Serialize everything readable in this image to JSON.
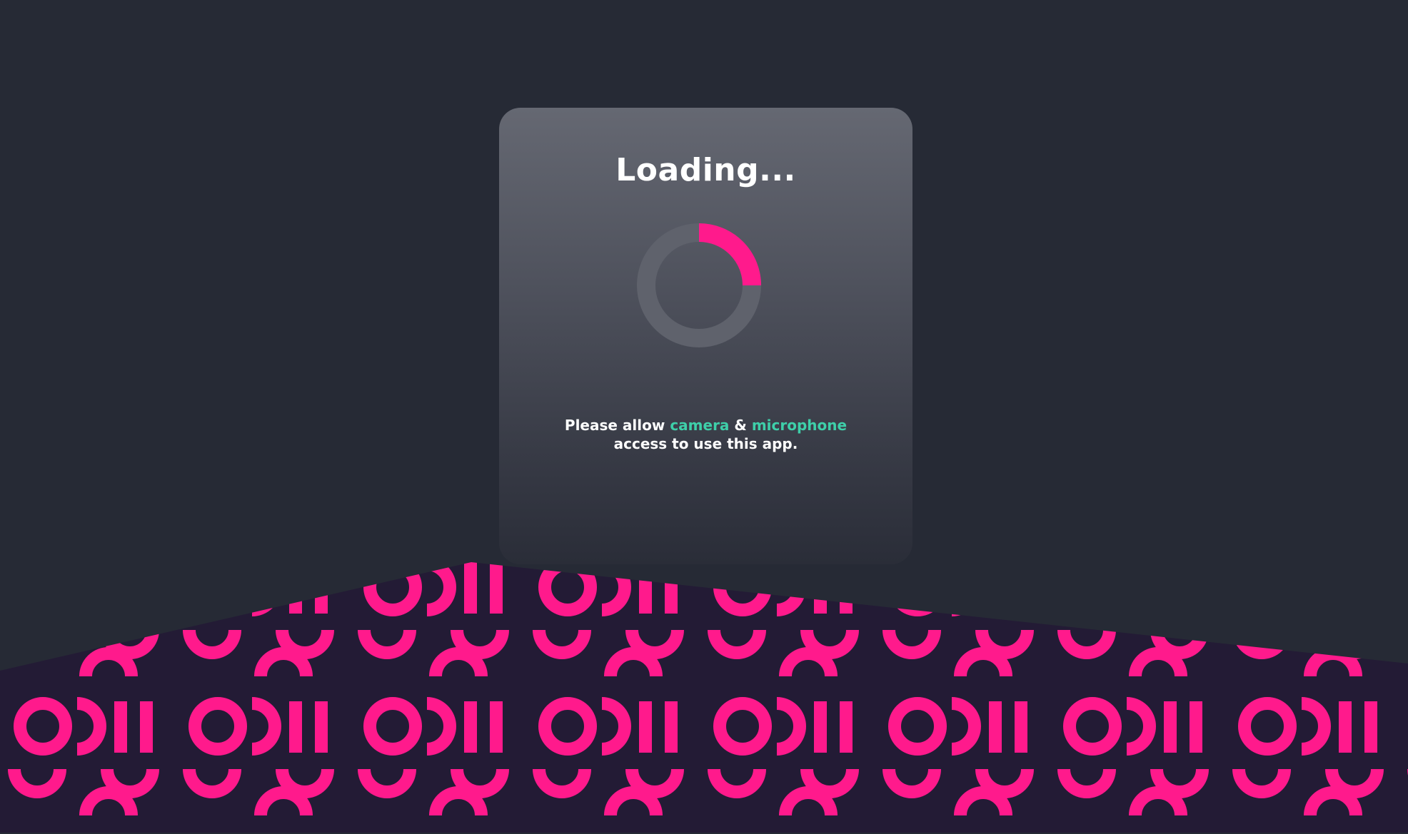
{
  "loader": {
    "title": "Loading...",
    "progress_fraction": 0.25
  },
  "permission_message": {
    "prefix": "Please allow ",
    "camera": "camera",
    "and": " & ",
    "microphone": "microphone",
    "suffix": "access to use this app."
  },
  "colors": {
    "background": "#262a35",
    "spinner_arc": "#ff1a8c",
    "spinner_track": "#5f626c",
    "link_accent": "#3ecfa9",
    "pattern_pink": "#ff1a8c",
    "pattern_dark": "#231b35"
  },
  "icons": {
    "spinner": "loading-spinner-icon"
  }
}
